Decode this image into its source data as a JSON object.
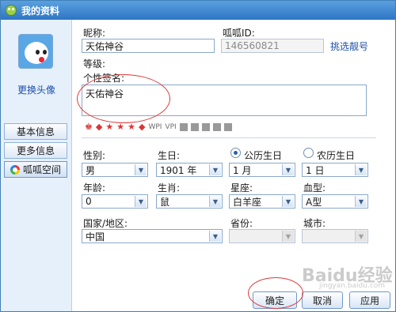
{
  "window": {
    "title": "我的资料"
  },
  "sidebar": {
    "change_avatar": "更换头像",
    "nav": [
      "基本信息",
      "更多信息",
      "呱呱空间"
    ]
  },
  "profile": {
    "nickname_label": "昵称:",
    "nickname_value": "天佑神谷",
    "id_label": "呱呱ID:",
    "id_value": "146560821",
    "choose_number": "挑选靓号",
    "level_label": "等级:",
    "signature_label": "个性签名:",
    "signature_value": "天佑神谷",
    "tag_text": [
      "WPI",
      "VPI"
    ]
  },
  "details": {
    "gender_label": "性别:",
    "gender_value": "男",
    "birthday_label": "生日:",
    "year_value": "1901 年",
    "month_value": "1 月",
    "day_value": "1 日",
    "solar_label": "公历生日",
    "lunar_label": "农历生日",
    "calendar_selected": "solar",
    "age_label": "年龄:",
    "age_value": "0",
    "zodiac_label": "生肖:",
    "zodiac_value": "鼠",
    "sign_label": "星座:",
    "sign_value": "白羊座",
    "blood_label": "血型:",
    "blood_value": "A型",
    "country_label": "国家/地区:",
    "country_value": "中国",
    "province_label": "省份:",
    "province_value": "",
    "city_label": "城市:",
    "city_value": ""
  },
  "buttons": {
    "ok": "确定",
    "cancel": "取消",
    "apply": "应用"
  },
  "watermark": {
    "main": "Baidu经验",
    "sub": "jingyan.baidu.com"
  },
  "colors": {
    "titlebar": "#2e75c4",
    "accent_link": "#1f4fa8",
    "annotation_circle": "#e03a3a"
  }
}
